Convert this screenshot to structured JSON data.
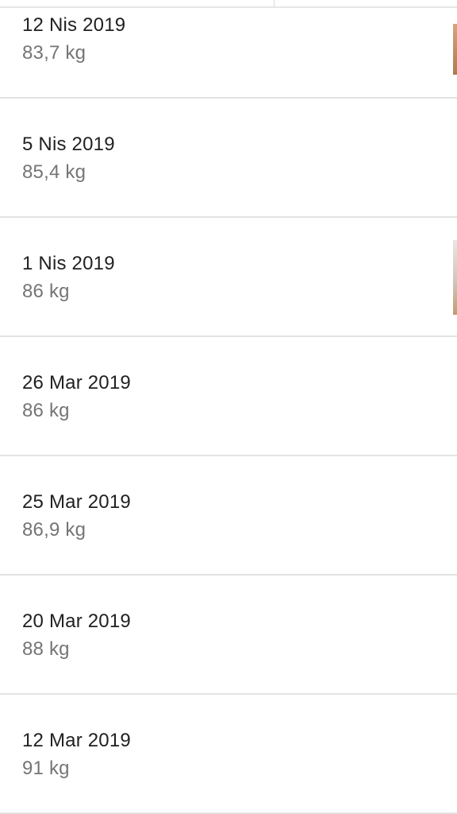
{
  "weight_log": {
    "entries": [
      {
        "date": "12 Nis 2019",
        "weight": "83,7 kg",
        "has_photo": true
      },
      {
        "date": "5 Nis 2019",
        "weight": "85,4 kg",
        "has_photo": false
      },
      {
        "date": "1 Nis 2019",
        "weight": "86 kg",
        "has_photo": true
      },
      {
        "date": "26 Mar 2019",
        "weight": "86 kg",
        "has_photo": false
      },
      {
        "date": "25 Mar 2019",
        "weight": "86,9 kg",
        "has_photo": false
      },
      {
        "date": "20 Mar 2019",
        "weight": "88 kg",
        "has_photo": false
      },
      {
        "date": "12 Mar 2019",
        "weight": "91 kg",
        "has_photo": false
      }
    ]
  }
}
